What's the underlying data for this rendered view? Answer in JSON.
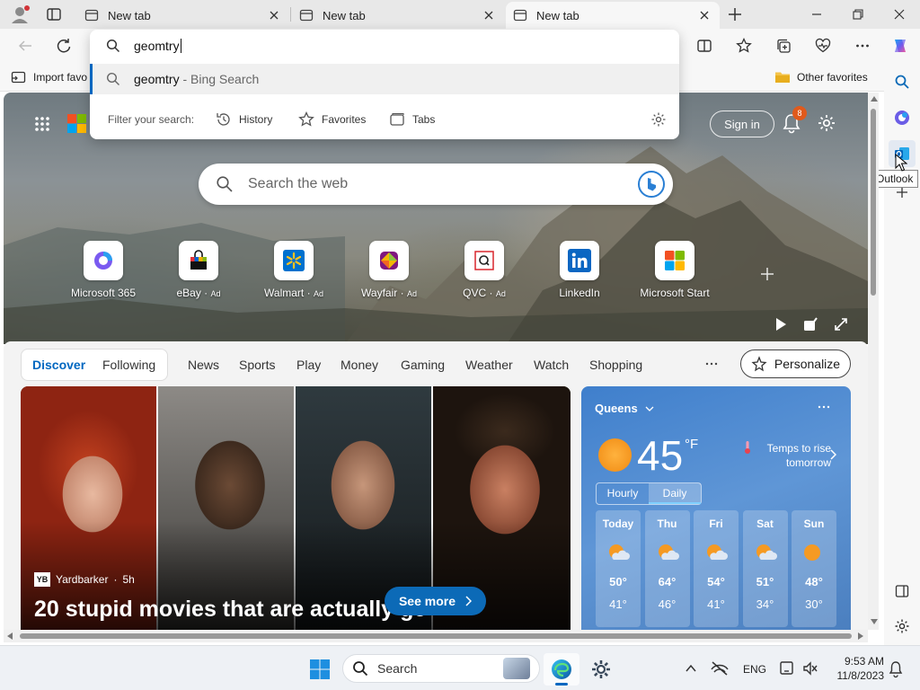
{
  "tabs": [
    {
      "title": "New tab"
    },
    {
      "title": "New tab"
    },
    {
      "title": "New tab"
    }
  ],
  "address": {
    "value": "geomtry"
  },
  "suggestions": [
    {
      "query": "geomtry",
      "suffix": " - Bing Search"
    }
  ],
  "filter": {
    "label": "Filter your search:",
    "items": [
      "History",
      "Favorites",
      "Tabs"
    ]
  },
  "favorites": {
    "import_label": "Import favo",
    "other_label": "Other favorites"
  },
  "sidebar_tooltip": "Outlook",
  "newtab": {
    "sign_in": "Sign in",
    "notification_count": "8",
    "search_placeholder": "Search the web"
  },
  "quick_links": [
    {
      "label": "Microsoft 365",
      "ad": ""
    },
    {
      "label": "eBay",
      "ad": "Ad"
    },
    {
      "label": "Walmart",
      "ad": "Ad"
    },
    {
      "label": "Wayfair",
      "ad": "Ad"
    },
    {
      "label": "QVC",
      "ad": "Ad"
    },
    {
      "label": "LinkedIn",
      "ad": ""
    },
    {
      "label": "Microsoft Start",
      "ad": ""
    }
  ],
  "feed": {
    "tabs": [
      "Discover",
      "Following",
      "News",
      "Sports",
      "Play",
      "Money",
      "Gaming",
      "Weather",
      "Watch",
      "Shopping"
    ],
    "personalize": "Personalize",
    "story": {
      "source": "Yardbarker",
      "age": "5h",
      "headline": "20 stupid movies that are actually ge",
      "see_more": "See more"
    }
  },
  "weather": {
    "location": "Queens",
    "temp": "45",
    "unit": "°F",
    "note_line1": "Temps to rise",
    "note_line2": "tomorrow",
    "toggle": [
      "Hourly",
      "Daily"
    ],
    "days": [
      {
        "day": "Today",
        "hi": "50°",
        "lo": "41°"
      },
      {
        "day": "Thu",
        "hi": "64°",
        "lo": "46°"
      },
      {
        "day": "Fri",
        "hi": "54°",
        "lo": "41°"
      },
      {
        "day": "Sat",
        "hi": "51°",
        "lo": "34°"
      },
      {
        "day": "Sun",
        "hi": "48°",
        "lo": "30°"
      }
    ]
  },
  "taskbar": {
    "search_label": "Search",
    "lang": "ENG",
    "time": "9:53 AM",
    "date": "11/8/2023"
  },
  "colors": {
    "accent": "#0067c0",
    "edge_blue": "#0c6ab7"
  }
}
